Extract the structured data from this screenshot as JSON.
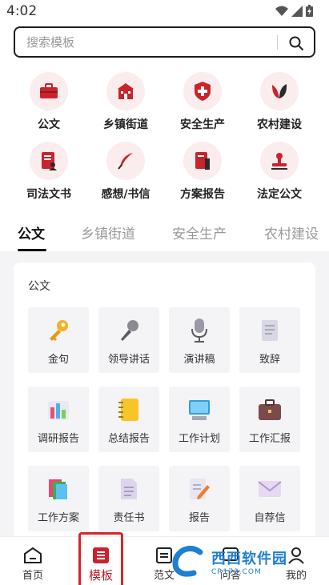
{
  "status_bar": {
    "time": "4:02"
  },
  "search": {
    "placeholder": "搜索模板"
  },
  "categories": [
    {
      "label": "公文",
      "icon": "briefcase-icon"
    },
    {
      "label": "乡镇街道",
      "icon": "building-icon"
    },
    {
      "label": "安全生产",
      "icon": "safety-shield-icon"
    },
    {
      "label": "农村建设",
      "icon": "leaf-icon"
    },
    {
      "label": "司法文书",
      "icon": "legal-doc-icon"
    },
    {
      "label": "感想/书信",
      "icon": "quill-icon"
    },
    {
      "label": "方案报告",
      "icon": "report-book-icon"
    },
    {
      "label": "法定公文",
      "icon": "seal-stamp-icon"
    }
  ],
  "tabs": [
    "公文",
    "乡镇街道",
    "安全生产",
    "农村建设"
  ],
  "card": {
    "title": "公文",
    "tiles": [
      {
        "label": "金句",
        "icon": "key-icon"
      },
      {
        "label": "领导讲话",
        "icon": "microphone-icon"
      },
      {
        "label": "演讲稿",
        "icon": "podcast-mic-icon"
      },
      {
        "label": "致辞",
        "icon": "document-icon"
      },
      {
        "label": "调研报告",
        "icon": "bar-chart-icon"
      },
      {
        "label": "总结报告",
        "icon": "notebook-icon"
      },
      {
        "label": "工作计划",
        "icon": "computer-icon"
      },
      {
        "label": "工作汇报",
        "icon": "briefcase-icon"
      },
      {
        "label": "工作方案",
        "icon": "books-icon"
      },
      {
        "label": "责任书",
        "icon": "page-icon"
      },
      {
        "label": "报告",
        "icon": "edit-doc-icon"
      },
      {
        "label": "自荐信",
        "icon": "envelope-icon"
      }
    ]
  },
  "bottom_nav": [
    {
      "label": "首页",
      "icon": "home-icon"
    },
    {
      "label": "模板",
      "icon": "template-icon"
    },
    {
      "label": "范文",
      "icon": "article-icon"
    },
    {
      "label": "问答",
      "icon": "qa-icon"
    },
    {
      "label": "我的",
      "icon": "user-icon"
    }
  ],
  "watermark": {
    "text": "西西软件园",
    "sub": "CR173.COM"
  },
  "colors": {
    "accent": "#c9232c",
    "icon_bg": "#fbeced",
    "tile_bg": "#f4f4f6"
  }
}
